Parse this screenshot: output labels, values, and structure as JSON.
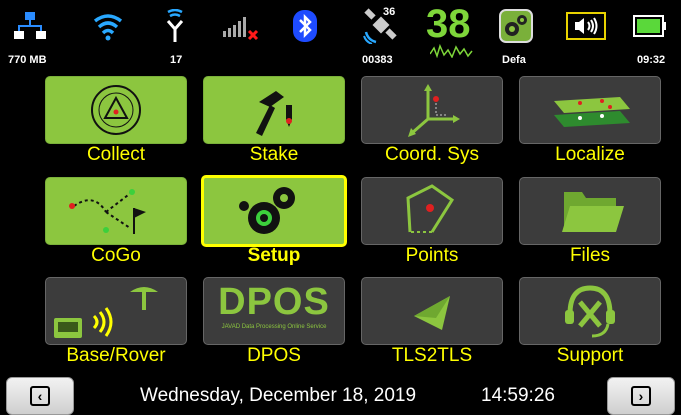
{
  "status": {
    "memory_label": "770 MB",
    "signal_count_label": "17",
    "satellite_count_top": "36",
    "satellite_id_label": "00383",
    "big_number": "38",
    "profile_label": "Defa",
    "time_label": "09:32"
  },
  "tiles": [
    {
      "label": "Collect"
    },
    {
      "label": "Stake"
    },
    {
      "label": "Coord. Sys"
    },
    {
      "label": "Localize"
    },
    {
      "label": "CoGo"
    },
    {
      "label": "Setup"
    },
    {
      "label": "Points"
    },
    {
      "label": "Files"
    },
    {
      "label": "Base/Rover"
    },
    {
      "label": "DPOS"
    },
    {
      "label": "TLS2TLS"
    },
    {
      "label": "Support"
    }
  ],
  "dpos_logo": {
    "title": "DPOS",
    "subtitle": "JAVAD Data Processing Online Service"
  },
  "footer": {
    "date": "Wednesday, December 18, 2019",
    "time": "14:59:26"
  },
  "colors": {
    "tile_label": "#ffff00",
    "green_tile": "#8cc63f",
    "selected_border": "#ffff00"
  }
}
